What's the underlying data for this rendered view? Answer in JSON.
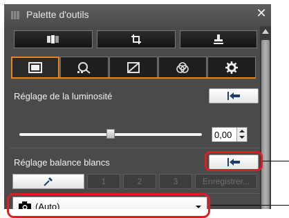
{
  "window": {
    "title": "Palette d'outils",
    "close_glyph": "✕"
  },
  "toolbar": {
    "buttons": [
      {
        "icon": "before-after-compare-icon"
      },
      {
        "icon": "crop-icon"
      },
      {
        "icon": "stamp-tool-icon"
      }
    ]
  },
  "tabs": [
    {
      "icon": "basic-image-adjust-icon",
      "active": true
    },
    {
      "icon": "detail-magnifier-icon",
      "active": false
    },
    {
      "icon": "tone-curve-icon",
      "active": false
    },
    {
      "icon": "color-adjust-icon",
      "active": false
    },
    {
      "icon": "settings-gear-icon",
      "active": false
    }
  ],
  "brightness": {
    "label": "Réglage de la luminosité",
    "reset_icon": "reset-arrow-icon",
    "value": "0,00",
    "slider_level": 0.5
  },
  "white_balance": {
    "label": "Réglage balance blancs",
    "reset_icon": "reset-arrow-icon",
    "eyedropper_icon": "eyedropper-icon",
    "presets": [
      "1",
      "2",
      "3"
    ],
    "register_label": "Enregistrer...",
    "selected": "(Auto)",
    "select_icon": "camera-icon"
  },
  "colors": {
    "tab_accent": "#e8851e",
    "highlight": "#e11d24",
    "panel_bg": "#4a4a4a"
  }
}
